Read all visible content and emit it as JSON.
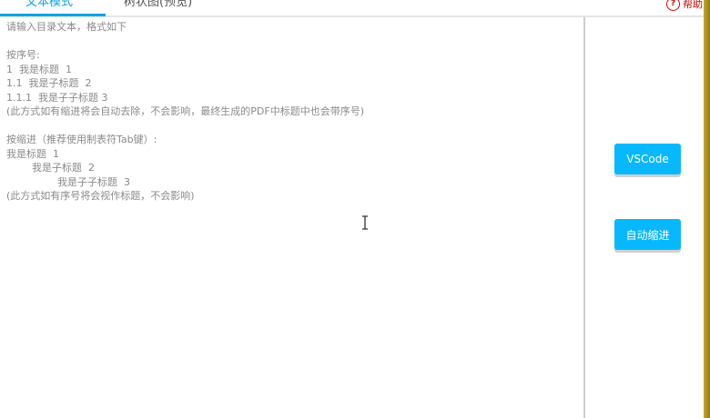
{
  "tabs": {
    "text_mode": "文本模式",
    "tree_preview": "树状图(预览)"
  },
  "help": {
    "icon": "question-circle-icon",
    "label": "帮助"
  },
  "editor": {
    "content": "请输入目录文本，格式如下\n\n按序号:\n1  我是标题  1\n1.1  我是子标题  2\n1.1.1  我是子子标题 3\n(此方式如有缩进将会自动去除，不会影响，最终生成的PDF中标题中也会带序号)\n\n按缩进（推荐使用制表符Tab键）:\n我是标题  1\n        我是子标题  2\n                我是子子标题  3\n(此方式如有序号将会视作标题，不会影响)"
  },
  "side": {
    "vscode_label": "VSCode",
    "auto_indent_label": "自动缩进"
  },
  "colors": {
    "accent": "#0aa3e8",
    "button": "#08b8ff",
    "help": "#d40000"
  }
}
